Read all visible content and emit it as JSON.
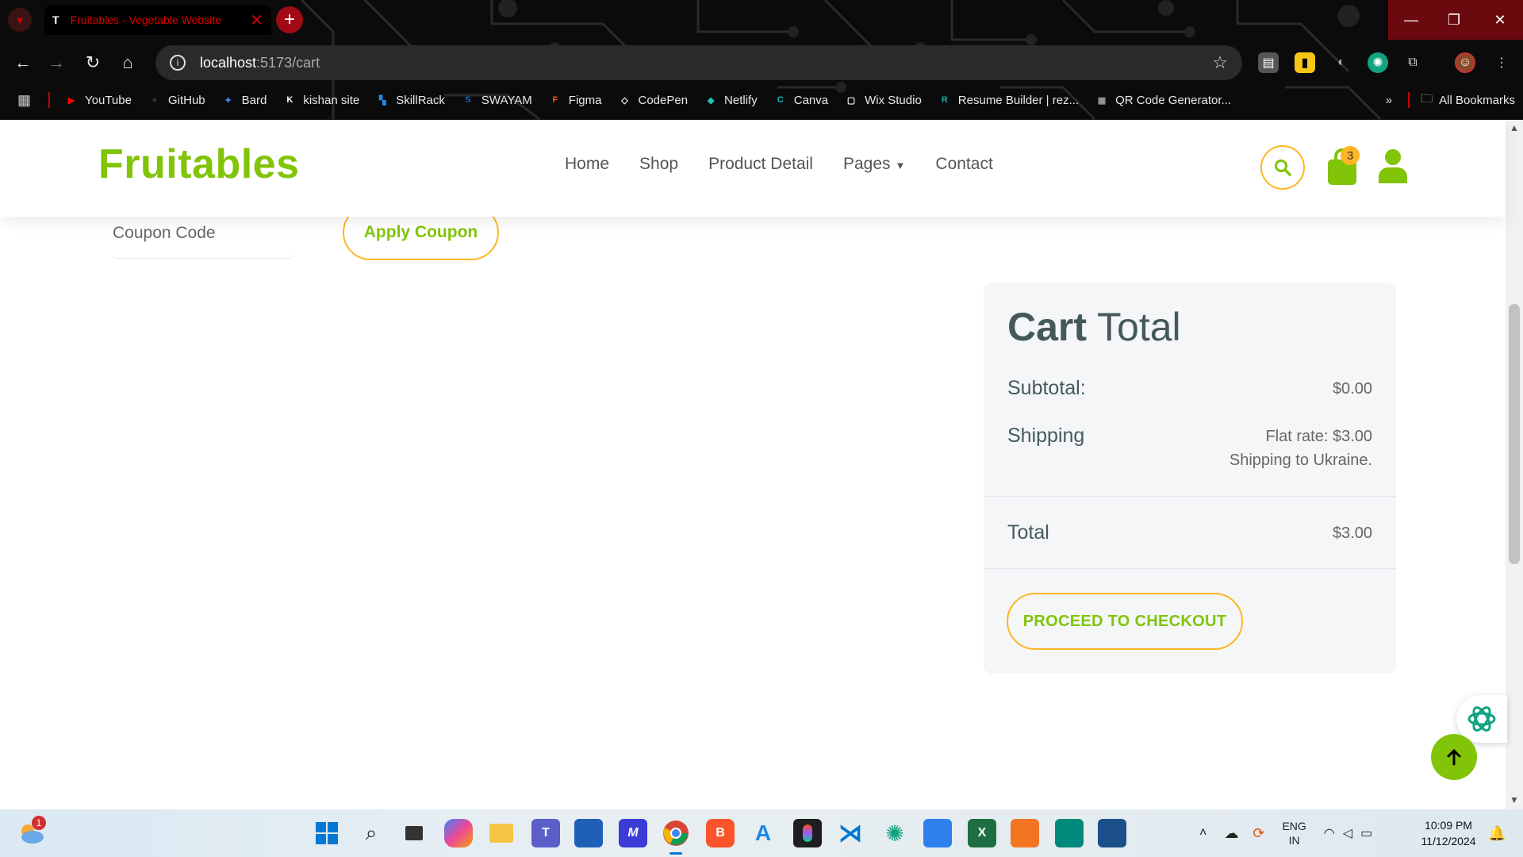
{
  "browser": {
    "tab_title": "Fruitables - Vegetable Website",
    "tab_favicon": "T",
    "url_host": "localhost",
    "url_path": ":5173/cart",
    "bookmarks": [
      {
        "label": "YouTube",
        "color": "#ff0000",
        "glyph": "▶"
      },
      {
        "label": "GitHub",
        "color": "#333333",
        "glyph": "●"
      },
      {
        "label": "Bard",
        "color": "#4285f4",
        "glyph": "✦"
      },
      {
        "label": "kishan site",
        "color": "#ffffff",
        "glyph": "K"
      },
      {
        "label": "SkillRack",
        "color": "#1e88e5",
        "glyph": "▚"
      },
      {
        "label": "SWAYAM",
        "color": "#1565c0",
        "glyph": "S"
      },
      {
        "label": "Figma",
        "color": "#f24e1e",
        "glyph": "F"
      },
      {
        "label": "CodePen",
        "color": "#ffffff",
        "glyph": "◇"
      },
      {
        "label": "Netlify",
        "color": "#20c6b7",
        "glyph": "◆"
      },
      {
        "label": "Canva",
        "color": "#00c4cc",
        "glyph": "C"
      },
      {
        "label": "Wix Studio",
        "color": "#ffffff",
        "glyph": "▢"
      },
      {
        "label": "Resume Builder | rez...",
        "color": "#26a69a",
        "glyph": "R"
      },
      {
        "label": "QR Code Generator...",
        "color": "#9e9e9e",
        "glyph": "▦"
      }
    ],
    "all_bookmarks": "All Bookmarks",
    "overflow": "»"
  },
  "site": {
    "logo": "Fruitables",
    "nav": {
      "home": "Home",
      "shop": "Shop",
      "product_detail": "Product Detail",
      "pages": "Pages",
      "contact": "Contact"
    },
    "cart_count": "3",
    "accent": "#81c408",
    "secondary": "#ffb524"
  },
  "coupon": {
    "placeholder": "Coupon Code",
    "apply_label": "Apply Coupon"
  },
  "cart_total": {
    "title_bold": "Cart",
    "title_rest": "Total",
    "subtotal_label": "Subtotal:",
    "subtotal_value": "$0.00",
    "shipping_label": "Shipping",
    "shipping_rate": "Flat rate: $3.00",
    "shipping_destination": "Shipping to Ukraine.",
    "total_label": "Total",
    "total_value": "$3.00",
    "checkout_label": "PROCEED TO CHECKOUT"
  },
  "taskbar": {
    "weather_badge": "1",
    "lang_top": "ENG",
    "lang_bottom": "IN",
    "time": "10:09 PM",
    "date": "11/12/2024"
  }
}
